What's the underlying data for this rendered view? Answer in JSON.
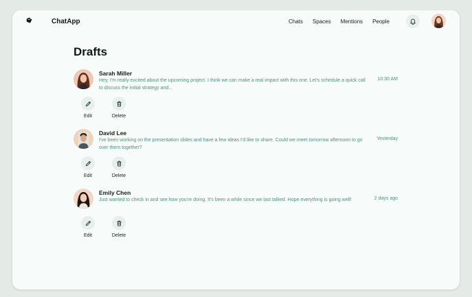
{
  "app": {
    "name": "ChatApp"
  },
  "nav": [
    {
      "label": "Chats"
    },
    {
      "label": "Spaces"
    },
    {
      "label": "Mentions"
    },
    {
      "label": "People"
    }
  ],
  "page": {
    "title": "Drafts"
  },
  "actions": {
    "edit_label": "Edit",
    "delete_label": "Delete"
  },
  "drafts": [
    {
      "name": "Sarah Miller",
      "message": "Hey, I'm really excited about the upcoming project. I think we can make a real impact with this one. Let's schedule a quick call to discuss the initial strategy and...",
      "time": "10:30 AM"
    },
    {
      "name": "David Lee",
      "message": "I've been working on the presentation slides and have a few ideas I'd like to share. Could we meet tomorrow afternoon to go over them together?",
      "time": "Yesterday"
    },
    {
      "name": "Emily Chen",
      "message": "Just wanted to check in and see how you're doing. It's been a while since we last talked. Hope everything is going well!",
      "time": "2 days ago"
    }
  ],
  "colors": {
    "accent_text": "#4a9478",
    "icon_bg": "#e6efeb",
    "window_bg": "#f7fbf9"
  }
}
